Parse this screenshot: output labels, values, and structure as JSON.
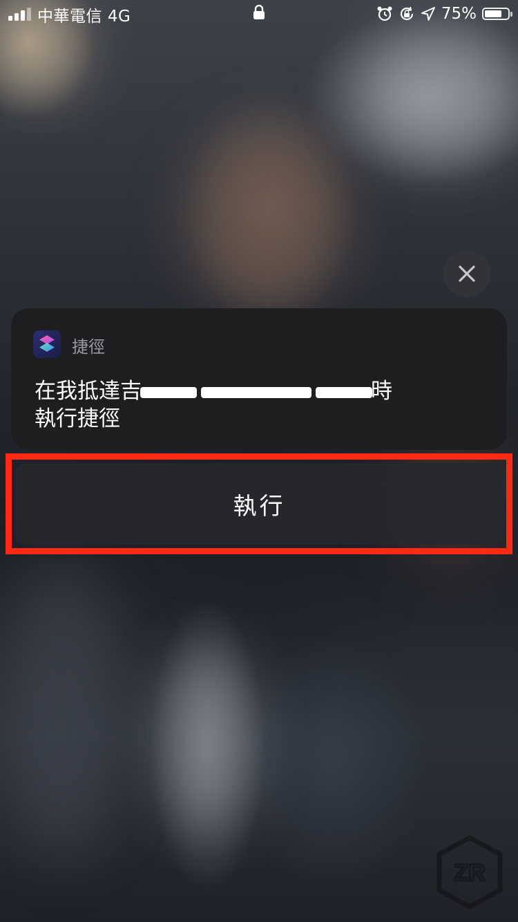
{
  "status_bar": {
    "carrier": "中華電信",
    "network": "4G",
    "battery_percent": "75%",
    "battery_level": 0.75,
    "icons": [
      "signal-bars-icon",
      "lock-icon",
      "alarm-icon",
      "rotation-lock-icon",
      "location-arrow-icon",
      "battery-icon"
    ]
  },
  "notification": {
    "app_name": "捷徑",
    "app_icon": "shortcuts-app-icon",
    "line1_prefix": "在我抵達",
    "line1_redacted_a": "吉",
    "line1_suffix": "時",
    "line2": "執行捷徑"
  },
  "action": {
    "run_label": "執行",
    "highlight_color": "#ff2a14"
  },
  "close": {
    "icon": "close-icon"
  },
  "watermark": {
    "text": "ZR"
  }
}
